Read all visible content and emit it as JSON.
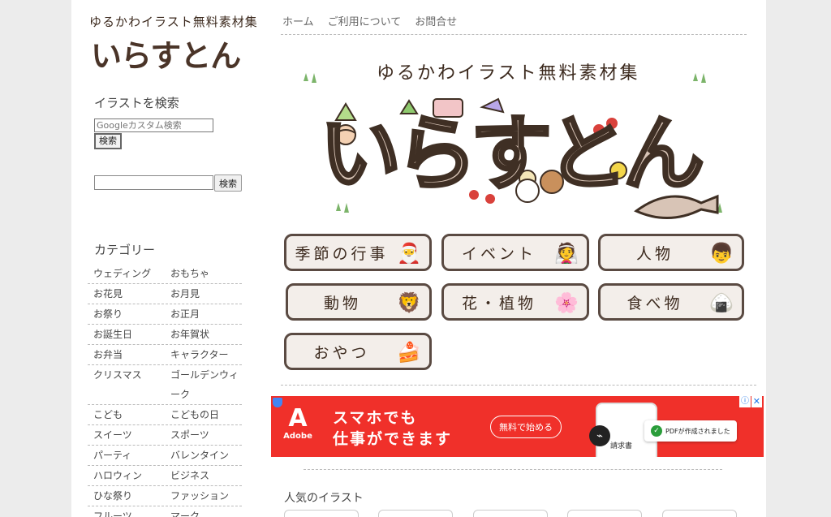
{
  "site": {
    "tagline": "ゆるかわイラスト無料素材集",
    "logo_text": "いらすとん",
    "colors": {
      "background": "#ececec",
      "ad_bg": "#f0302a",
      "button_border": "#5a4a42"
    }
  },
  "nav": {
    "items": [
      "ホーム",
      "ご利用について",
      "お問合せ"
    ]
  },
  "search": {
    "heading": "イラストを検索",
    "gcse_placeholder": "Googleカスタム検索",
    "gcse_button": "検索",
    "site_button": "検索"
  },
  "categories": {
    "heading": "カテゴリー",
    "rows": [
      [
        "ウェディング",
        "おもちゃ"
      ],
      [
        "お花見",
        "お月見"
      ],
      [
        "お祭り",
        "お正月"
      ],
      [
        "お誕生日",
        "お年賀状"
      ],
      [
        "お弁当",
        "キャラクター"
      ],
      [
        "クリスマス",
        "ゴールデンウィーク"
      ],
      [
        "こども",
        "こどもの日"
      ],
      [
        "スイーツ",
        "スポーツ"
      ],
      [
        "パーティ",
        "バレンタイン"
      ],
      [
        "ハロウィン",
        "ビジネス"
      ],
      [
        "ひな祭り",
        "ファッション"
      ],
      [
        "フルーツ",
        "マーク"
      ]
    ]
  },
  "hero": {
    "subtitle": "ゆるかわイラスト無料素材集",
    "title": "いらすとん"
  },
  "category_buttons": [
    {
      "label": "季節の行事",
      "icon": "santa-icon",
      "glyph": "🎅"
    },
    {
      "label": "イベント",
      "icon": "wedding-couple-icon",
      "glyph": "👰"
    },
    {
      "label": "人物",
      "icon": "person-icon",
      "glyph": "👦"
    },
    {
      "label": "動物",
      "icon": "lion-icon",
      "glyph": "🦁"
    },
    {
      "label": "花・植物",
      "icon": "flower-icon",
      "glyph": "🌸"
    },
    {
      "label": "食べ物",
      "icon": "onigiri-icon",
      "glyph": "🍙"
    },
    {
      "label": "おやつ",
      "icon": "cake-icon",
      "glyph": "🍰"
    }
  ],
  "ad": {
    "brand": "Adobe",
    "line1": "スマホでも",
    "line2": "仕事ができます",
    "cta": "無料で始める",
    "doc_label": "請求書",
    "toast": "PDFが作成されました"
  },
  "popular": {
    "heading": "人気のイラスト"
  }
}
